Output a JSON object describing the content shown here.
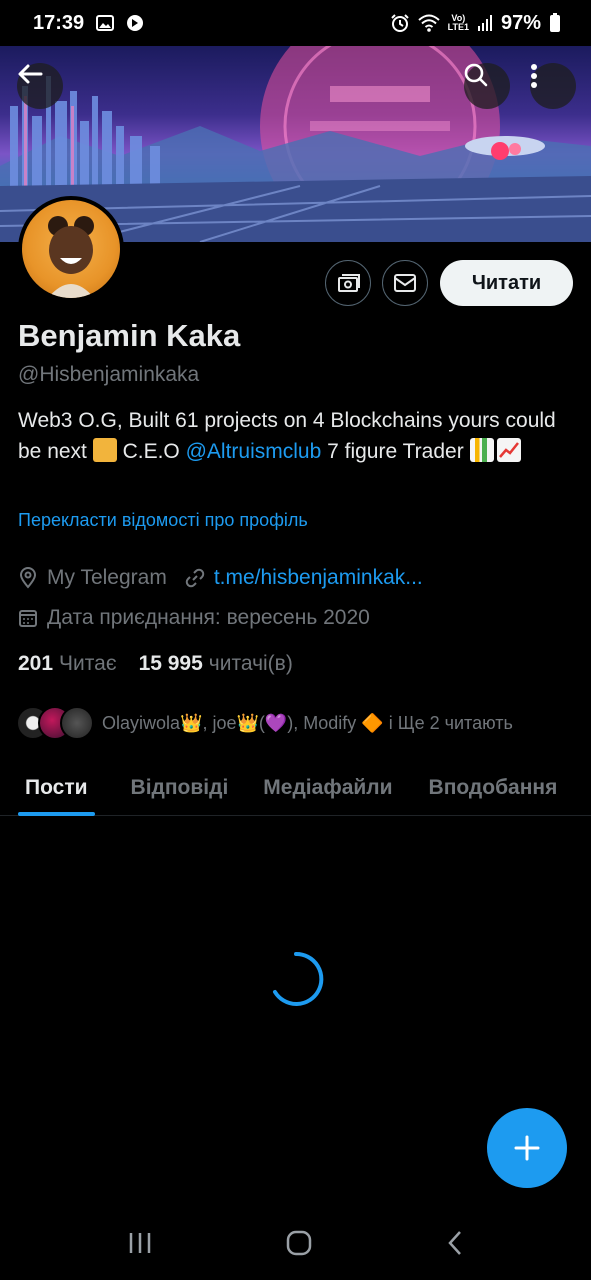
{
  "status_bar": {
    "time": "17:39",
    "battery": "97%",
    "network": "LTE1"
  },
  "profile": {
    "name": "Benjamin Kaka",
    "handle": "@Hisbenjaminkaka",
    "bio_part1": "Web3 O.G, Built 61 projects on 4 Blockchains yours could be next ",
    "bio_part2": " C.E.O ",
    "bio_mention": "@Altruismclub",
    "bio_part3": " 7 figure Trader ",
    "translate_link": "Перекласти відомості про профіль",
    "location": "My Telegram",
    "website": "t.me/hisbenjaminkak...",
    "joined": "Дата приєднання: вересень 2020",
    "following_count": "201",
    "following_label": "Читає",
    "followers_count": "15 995",
    "followers_label": "читачі(в)",
    "known_followers_text": "Olayiwola👑, joe👑(💜), Modify 🔶  і Ще 2 читають"
  },
  "actions": {
    "follow_label": "Читати"
  },
  "tabs": [
    {
      "label": "Пости",
      "active": true
    },
    {
      "label": "Відповіді",
      "active": false
    },
    {
      "label": "Медіафайли",
      "active": false
    },
    {
      "label": "Вподобання",
      "active": false
    }
  ],
  "colors": {
    "accent": "#1d9bf0",
    "background": "#000000",
    "secondary_text": "#71767b"
  }
}
